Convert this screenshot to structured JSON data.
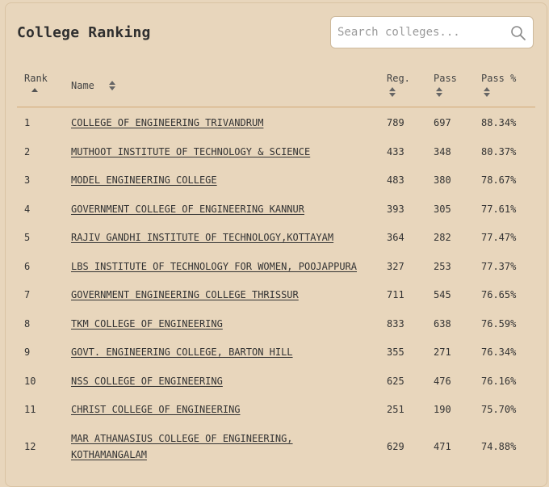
{
  "title": "College Ranking",
  "search": {
    "placeholder": "Search colleges..."
  },
  "columns": {
    "rank": "Rank",
    "name": "Name",
    "reg": "Reg.",
    "pass": "Pass",
    "pass_pct": "Pass %"
  },
  "rows": [
    {
      "rank": "1",
      "name": "COLLEGE OF ENGINEERING TRIVANDRUM",
      "reg": "789",
      "pass": "697",
      "pct": "88.34%"
    },
    {
      "rank": "2",
      "name": "MUTHOOT INSTITUTE OF TECHNOLOGY & SCIENCE",
      "reg": "433",
      "pass": "348",
      "pct": "80.37%"
    },
    {
      "rank": "3",
      "name": "MODEL ENGINEERING COLLEGE",
      "reg": "483",
      "pass": "380",
      "pct": "78.67%"
    },
    {
      "rank": "4",
      "name": "GOVERNMENT COLLEGE OF ENGINEERING KANNUR",
      "reg": "393",
      "pass": "305",
      "pct": "77.61%"
    },
    {
      "rank": "5",
      "name": "RAJIV GANDHI INSTITUTE OF TECHNOLOGY,KOTTAYAM",
      "reg": "364",
      "pass": "282",
      "pct": "77.47%"
    },
    {
      "rank": "6",
      "name": "LBS INSTITUTE OF TECHNOLOGY FOR WOMEN, POOJAPPURA",
      "reg": "327",
      "pass": "253",
      "pct": "77.37%"
    },
    {
      "rank": "7",
      "name": "GOVERNMENT ENGINEERING COLLEGE THRISSUR",
      "reg": "711",
      "pass": "545",
      "pct": "76.65%"
    },
    {
      "rank": "8",
      "name": "TKM COLLEGE OF ENGINEERING",
      "reg": "833",
      "pass": "638",
      "pct": "76.59%"
    },
    {
      "rank": "9",
      "name": "GOVT. ENGINEERING COLLEGE, BARTON HILL",
      "reg": "355",
      "pass": "271",
      "pct": "76.34%"
    },
    {
      "rank": "10",
      "name": "NSS COLLEGE OF ENGINEERING",
      "reg": "625",
      "pass": "476",
      "pct": "76.16%"
    },
    {
      "rank": "11",
      "name": "CHRIST COLLEGE OF ENGINEERING",
      "reg": "251",
      "pass": "190",
      "pct": "75.70%"
    },
    {
      "rank": "12",
      "name": "MAR ATHANASIUS COLLEGE OF ENGINEERING, KOTHAMANGALAM",
      "reg": "629",
      "pass": "471",
      "pct": "74.88%"
    }
  ]
}
